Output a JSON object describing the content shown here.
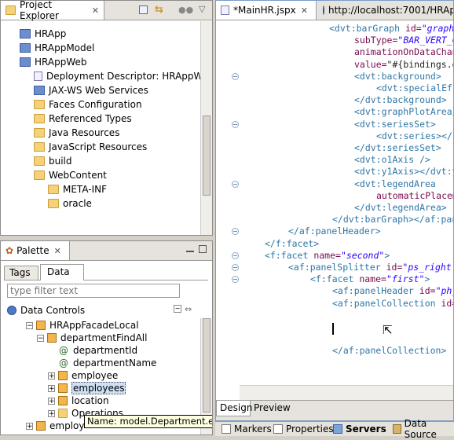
{
  "project_explorer": {
    "title": "Project Explorer",
    "items": [
      {
        "label": "HRApp",
        "icon": "project-icon",
        "indent": 0
      },
      {
        "label": "HRAppModel",
        "icon": "project-icon",
        "indent": 0
      },
      {
        "label": "HRAppWeb",
        "icon": "project-icon",
        "indent": 0
      },
      {
        "label": "Deployment Descriptor: HRAppWe",
        "icon": "descriptor-icon",
        "indent": 1
      },
      {
        "label": "JAX-WS Web Services",
        "icon": "webservice-icon",
        "indent": 1
      },
      {
        "label": "Faces Configuration",
        "icon": "faces-config-icon",
        "indent": 1
      },
      {
        "label": "Referenced Types",
        "icon": "folder-icon",
        "indent": 1
      },
      {
        "label": "Java Resources",
        "icon": "folder-icon",
        "indent": 1
      },
      {
        "label": "JavaScript Resources",
        "icon": "javascript-icon",
        "indent": 1
      },
      {
        "label": "build",
        "icon": "folder-icon",
        "indent": 1
      },
      {
        "label": "WebContent",
        "icon": "folder-icon",
        "indent": 1
      },
      {
        "label": "META-INF",
        "icon": "folder-icon",
        "indent": 2
      },
      {
        "label": "oracle",
        "icon": "folder-icon",
        "indent": 2
      }
    ]
  },
  "palette": {
    "title": "Palette",
    "tabs": [
      "Tags",
      "Data"
    ],
    "active_tab": "Data",
    "filter_placeholder": "type filter text",
    "section": "Data Controls",
    "tree": [
      {
        "label": "HRAppFacadeLocal",
        "icon": "table-icon",
        "expander": "−",
        "indent": 1
      },
      {
        "label": "departmentFindAll",
        "icon": "table-icon",
        "expander": "−",
        "indent": 2
      },
      {
        "label": "departmentId",
        "icon": "attribute-icon",
        "expander": "",
        "indent": 3
      },
      {
        "label": "departmentName",
        "icon": "attribute-icon",
        "expander": "",
        "indent": 3
      },
      {
        "label": "employee",
        "icon": "table-icon",
        "expander": "+",
        "indent": 3
      },
      {
        "label": "employees",
        "icon": "table-icon",
        "expander": "+",
        "indent": 3,
        "selected": true
      },
      {
        "label": "location",
        "icon": "table-icon",
        "expander": "+",
        "indent": 3
      },
      {
        "label": "Operations",
        "icon": "folder-icon",
        "expander": "+",
        "indent": 3
      },
      {
        "label": "employ",
        "icon": "table-icon",
        "expander": "+",
        "indent": 1
      }
    ],
    "tooltip": "Name: model.Department.employees"
  },
  "editor": {
    "tabs": [
      {
        "label": "*MainHR.jspx",
        "active": true
      },
      {
        "label": "http://localhost:7001/HRApp",
        "active": false
      }
    ],
    "bottom_tabs": [
      "Design",
      "Preview"
    ],
    "active_bottom_tab": "Design",
    "code_lines": [
      [
        {
          "c": "tag",
          "t": "<dvt:barGraph "
        },
        {
          "c": "attr",
          "t": "id="
        },
        {
          "c": "val",
          "t": "\"graph"
        }
      ],
      [
        {
          "c": "attr",
          "t": "subType="
        },
        {
          "c": "val",
          "t": "\"BAR_VERT_C"
        }
      ],
      [
        {
          "c": "attr",
          "t": "animationOnDataChan"
        }
      ],
      [
        {
          "c": "attr",
          "t": "value="
        },
        {
          "c": "plain",
          "t": "\"#{bindings.d"
        }
      ],
      [
        {
          "c": "tag",
          "t": "<dvt:background>"
        }
      ],
      [
        {
          "c": "tag",
          "t": "<dvt:specialEff"
        }
      ],
      [
        {
          "c": "tag",
          "t": "</dvt:background>"
        }
      ],
      [
        {
          "c": "tag",
          "t": "<dvt:graphPlotArea/"
        }
      ],
      [
        {
          "c": "tag",
          "t": "<dvt:seriesSet>"
        }
      ],
      [
        {
          "c": "tag",
          "t": "<dvt:series></"
        }
      ],
      [
        {
          "c": "tag",
          "t": "</dvt:seriesSet>"
        }
      ],
      [
        {
          "c": "tag",
          "t": "<dvt:o1Axis />"
        }
      ],
      [
        {
          "c": "tag",
          "t": "<dvt:y1Axis></dvt:y"
        }
      ],
      [
        {
          "c": "tag",
          "t": "<dvt:legendArea"
        }
      ],
      [
        {
          "c": "attr",
          "t": "automaticPlacem"
        }
      ],
      [
        {
          "c": "tag",
          "t": "</dvt:legendArea>"
        }
      ],
      [
        {
          "c": "tag",
          "t": "</dvt:barGraph></af:pan"
        }
      ],
      [
        {
          "c": "tag",
          "t": "</af:panelHeader>"
        }
      ],
      [
        {
          "c": "tag",
          "t": "</f:facet>"
        }
      ],
      [
        {
          "c": "tag",
          "t": "<f:facet "
        },
        {
          "c": "attr",
          "t": "name="
        },
        {
          "c": "val",
          "t": "\"second\""
        },
        {
          "c": "tag",
          "t": ">"
        }
      ],
      [
        {
          "c": "tag",
          "t": "<af:panelSplitter "
        },
        {
          "c": "attr",
          "t": "id="
        },
        {
          "c": "val",
          "t": "\"ps_right"
        }
      ],
      [
        {
          "c": "tag",
          "t": "<f:facet "
        },
        {
          "c": "attr",
          "t": "name="
        },
        {
          "c": "val",
          "t": "\"first\""
        },
        {
          "c": "tag",
          "t": ">"
        }
      ],
      [
        {
          "c": "tag",
          "t": "<af:panelHeader "
        },
        {
          "c": "attr",
          "t": "id="
        },
        {
          "c": "val",
          "t": "\"ph_"
        }
      ],
      [
        {
          "c": "tag",
          "t": "<af:panelCollection "
        },
        {
          "c": "attr",
          "t": "id="
        }
      ],
      [
        {
          "c": "tag",
          "t": "</af:panelCollection>"
        }
      ]
    ]
  },
  "bottom_bar": {
    "tabs": [
      "Markers",
      "Properties",
      "Servers",
      "Data Source"
    ]
  }
}
